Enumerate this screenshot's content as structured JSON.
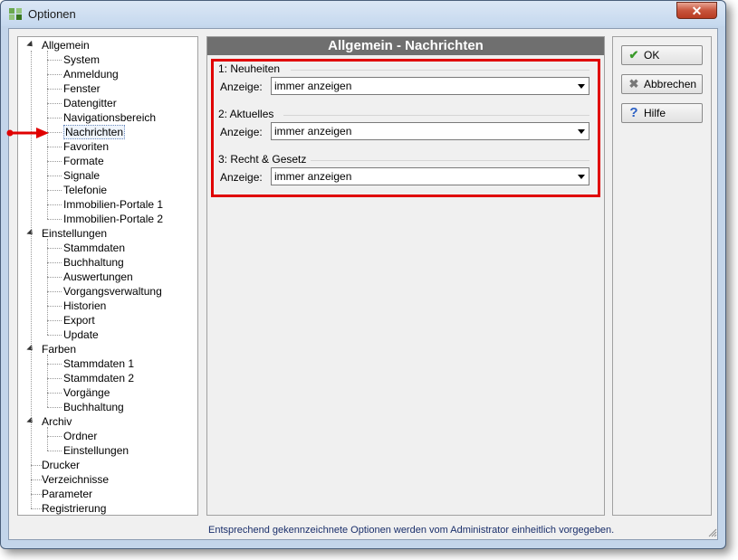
{
  "window": {
    "title": "Optionen",
    "close_label": "✕"
  },
  "tree": {
    "items": [
      {
        "label": "Allgemein",
        "level": 0,
        "expanded": true
      },
      {
        "label": "System",
        "level": 1
      },
      {
        "label": "Anmeldung",
        "level": 1
      },
      {
        "label": "Fenster",
        "level": 1
      },
      {
        "label": "Datengitter",
        "level": 1
      },
      {
        "label": "Navigationsbereich",
        "level": 1
      },
      {
        "label": "Nachrichten",
        "level": 1,
        "selected": true
      },
      {
        "label": "Favoriten",
        "level": 1
      },
      {
        "label": "Formate",
        "level": 1
      },
      {
        "label": "Signale",
        "level": 1
      },
      {
        "label": "Telefonie",
        "level": 1
      },
      {
        "label": "Immobilien-Portale 1",
        "level": 1
      },
      {
        "label": "Immobilien-Portale 2",
        "level": 1
      },
      {
        "label": "Einstellungen",
        "level": 0,
        "expanded": true
      },
      {
        "label": "Stammdaten",
        "level": 1
      },
      {
        "label": "Buchhaltung",
        "level": 1
      },
      {
        "label": "Auswertungen",
        "level": 1
      },
      {
        "label": "Vorgangsverwaltung",
        "level": 1
      },
      {
        "label": "Historien",
        "level": 1
      },
      {
        "label": "Export",
        "level": 1
      },
      {
        "label": "Update",
        "level": 1
      },
      {
        "label": "Farben",
        "level": 0,
        "expanded": true
      },
      {
        "label": "Stammdaten 1",
        "level": 1
      },
      {
        "label": "Stammdaten 2",
        "level": 1
      },
      {
        "label": "Vorgänge",
        "level": 1
      },
      {
        "label": "Buchhaltung",
        "level": 1
      },
      {
        "label": "Archiv",
        "level": 0,
        "expanded": true
      },
      {
        "label": "Ordner",
        "level": 1
      },
      {
        "label": "Einstellungen",
        "level": 1
      },
      {
        "label": "Drucker",
        "level": 0
      },
      {
        "label": "Verzeichnisse",
        "level": 0
      },
      {
        "label": "Parameter",
        "level": 0
      },
      {
        "label": "Registrierung",
        "level": 0
      }
    ]
  },
  "pane": {
    "title": "Allgemein - Nachrichten",
    "groups": [
      {
        "title": "1: Neuheiten",
        "label": "Anzeige:",
        "value": "immer anzeigen"
      },
      {
        "title": "2: Aktuelles",
        "label": "Anzeige:",
        "value": "immer anzeigen"
      },
      {
        "title": "3: Recht & Gesetz",
        "label": "Anzeige:",
        "value": "immer anzeigen"
      }
    ]
  },
  "buttons": {
    "ok": "OK",
    "cancel": "Abbrechen",
    "help": "Hilfe"
  },
  "footer": "Entsprechend gekennzeichnete Optionen werden vom Administrator einheitlich vorgegeben.",
  "colors": {
    "highlight": "#e00000",
    "header_bg": "#6f6f6f",
    "arrow": "#e00000"
  }
}
